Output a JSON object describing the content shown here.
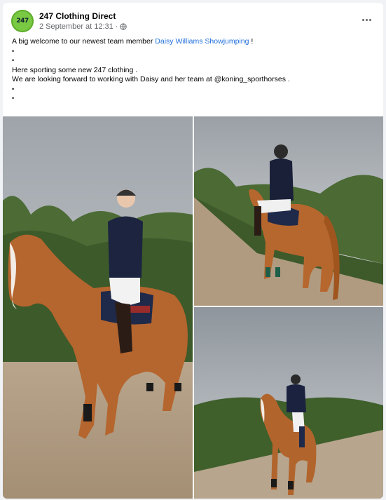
{
  "post": {
    "page_name": "247 Clothing Direct",
    "avatar_text": "247",
    "timestamp": "2 September at 12:31",
    "separator": "·",
    "privacy_icon": "globe-icon",
    "more_icon": "more-horizontal-icon",
    "text": {
      "line1_prefix": "A big welcome to our newest team member ",
      "line1_link": "Daisy Williams Showjumping",
      "line1_suffix": " !",
      "bullet": "•",
      "line4": "Here sporting some new 247 clothing .",
      "line5": "We are looking forward to working with Daisy and her team at @koning_sporthorses ."
    }
  },
  "photos": [
    {
      "description": "photo-1"
    },
    {
      "description": "photo-2"
    },
    {
      "description": "photo-3"
    }
  ],
  "colors": {
    "link": "#216fdb",
    "meta": "#65676b",
    "avatar": "#7ac943",
    "background": "#f0f2f5"
  }
}
